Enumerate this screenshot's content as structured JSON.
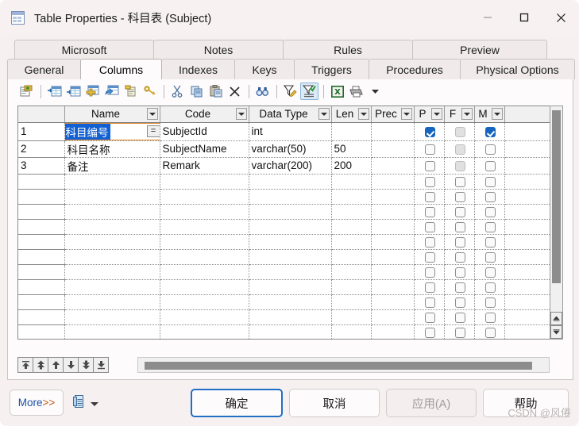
{
  "window": {
    "title": "Table Properties - 科目表 (Subject)",
    "icon": "table-icon",
    "minimize": "minimize-icon",
    "maximize": "maximize-icon",
    "close": "close-icon"
  },
  "tabs": {
    "top_row": [
      {
        "label": "Microsoft",
        "selected": false
      },
      {
        "label": "Notes",
        "selected": false
      },
      {
        "label": "Rules",
        "selected": false
      },
      {
        "label": "Preview",
        "selected": false
      }
    ],
    "bottom_row": [
      {
        "label": "General",
        "selected": false
      },
      {
        "label": "Columns",
        "selected": true
      },
      {
        "label": "Indexes",
        "selected": false
      },
      {
        "label": "Keys",
        "selected": false
      },
      {
        "label": "Triggers",
        "selected": false
      },
      {
        "label": "Procedures",
        "selected": false
      },
      {
        "label": "Physical Options",
        "selected": false
      }
    ]
  },
  "toolbar": {
    "buttons": [
      {
        "name": "properties-icon",
        "active": false
      },
      {
        "name": "insert-row-before-icon",
        "active": false
      },
      {
        "name": "insert-row-after-icon",
        "active": false
      },
      {
        "name": "add-row-icon",
        "active": false
      },
      {
        "name": "duplicate-row-icon",
        "active": false
      },
      {
        "name": "paste-row-icon",
        "active": false
      },
      {
        "name": "primary-key-icon",
        "active": false
      },
      {
        "name": "cut-icon",
        "active": false
      },
      {
        "name": "copy-icon",
        "active": false
      },
      {
        "name": "paste-icon",
        "active": false
      },
      {
        "name": "delete-icon",
        "active": false
      },
      {
        "name": "find-icon",
        "active": false
      },
      {
        "name": "edit-filter-icon",
        "active": false
      },
      {
        "name": "apply-filter-icon",
        "active": true
      },
      {
        "name": "export-excel-icon",
        "active": false
      },
      {
        "name": "print-icon",
        "active": false
      },
      {
        "name": "print-dropdown-icon",
        "active": false
      }
    ]
  },
  "grid": {
    "columns": [
      {
        "key": "rownum",
        "label": "",
        "dropdown": false,
        "width": 58
      },
      {
        "key": "name",
        "label": "Name",
        "dropdown": true,
        "width": 120
      },
      {
        "key": "code",
        "label": "Code",
        "dropdown": true,
        "width": 112
      },
      {
        "key": "datatype",
        "label": "Data Type",
        "dropdown": true,
        "width": 104
      },
      {
        "key": "len",
        "label": "Len",
        "dropdown": true,
        "width": 50
      },
      {
        "key": "prec",
        "label": "Prec",
        "dropdown": true,
        "width": 54
      },
      {
        "key": "p",
        "label": "P",
        "dropdown": true,
        "width": 38
      },
      {
        "key": "f",
        "label": "F",
        "dropdown": true,
        "width": 38
      },
      {
        "key": "m",
        "label": "M",
        "dropdown": true,
        "width": 38
      },
      {
        "key": "spacer",
        "label": "",
        "dropdown": false,
        "width": 67
      }
    ],
    "rows": [
      {
        "rownum": "1",
        "name": "科目编号",
        "name_editing": true,
        "eq_button": "=",
        "code": "SubjectId",
        "datatype": "int",
        "len": "",
        "prec": "",
        "p": "checked",
        "f": "disabled",
        "m": "checked"
      },
      {
        "rownum": "2",
        "name": "科目名称",
        "name_editing": false,
        "code": "SubjectName",
        "datatype": "varchar(50)",
        "len": "50",
        "prec": "",
        "p": "unchecked",
        "f": "disabled",
        "m": "unchecked"
      },
      {
        "rownum": "3",
        "name": "备注",
        "name_editing": false,
        "code": "Remark",
        "datatype": "varchar(200)",
        "len": "200",
        "prec": "",
        "p": "unchecked",
        "f": "disabled",
        "m": "unchecked"
      }
    ],
    "empty_row_count": 11,
    "vertical_scrollbar": {
      "name": "vertical-scrollbar",
      "up": "scroll-up-icon",
      "down": "scroll-down-icon"
    },
    "horizontal_scrollbar": {
      "name": "horizontal-scrollbar"
    },
    "row_nav": [
      {
        "name": "nav-first-icon"
      },
      {
        "name": "nav-prev-page-icon"
      },
      {
        "name": "nav-prev-icon"
      },
      {
        "name": "nav-next-icon"
      },
      {
        "name": "nav-next-page-icon"
      },
      {
        "name": "nav-last-icon"
      }
    ]
  },
  "footer": {
    "more_label_main": "More",
    "more_label_arrows": ">>",
    "doc_icon": "document-icon",
    "doc_caret": "chevron-down-icon",
    "ok_label": "确定",
    "cancel_label": "取消",
    "apply_label": "应用(A)",
    "help_label": "帮助",
    "watermark": "CSDN @风倦"
  },
  "colors": {
    "accent": "#1f6fc4",
    "checkbox_checked": "#1565c0",
    "selection": "#1160d4",
    "edit_border": "#e08a2c",
    "toolbar_active": "#dbeaf7"
  }
}
